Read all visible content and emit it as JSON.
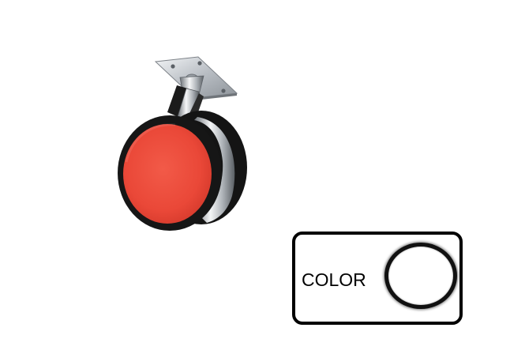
{
  "product": {
    "icon": "caster-wheel-icon",
    "wheel_color": "#ee4a3a",
    "tire_color": "#151515",
    "metal_color": "#c9cdd2"
  },
  "color_option": {
    "label": "COLOR",
    "swatch_icon": "color-swatch-ring-icon",
    "swatch_fill": "#ffffff",
    "swatch_ring": "#111111"
  }
}
